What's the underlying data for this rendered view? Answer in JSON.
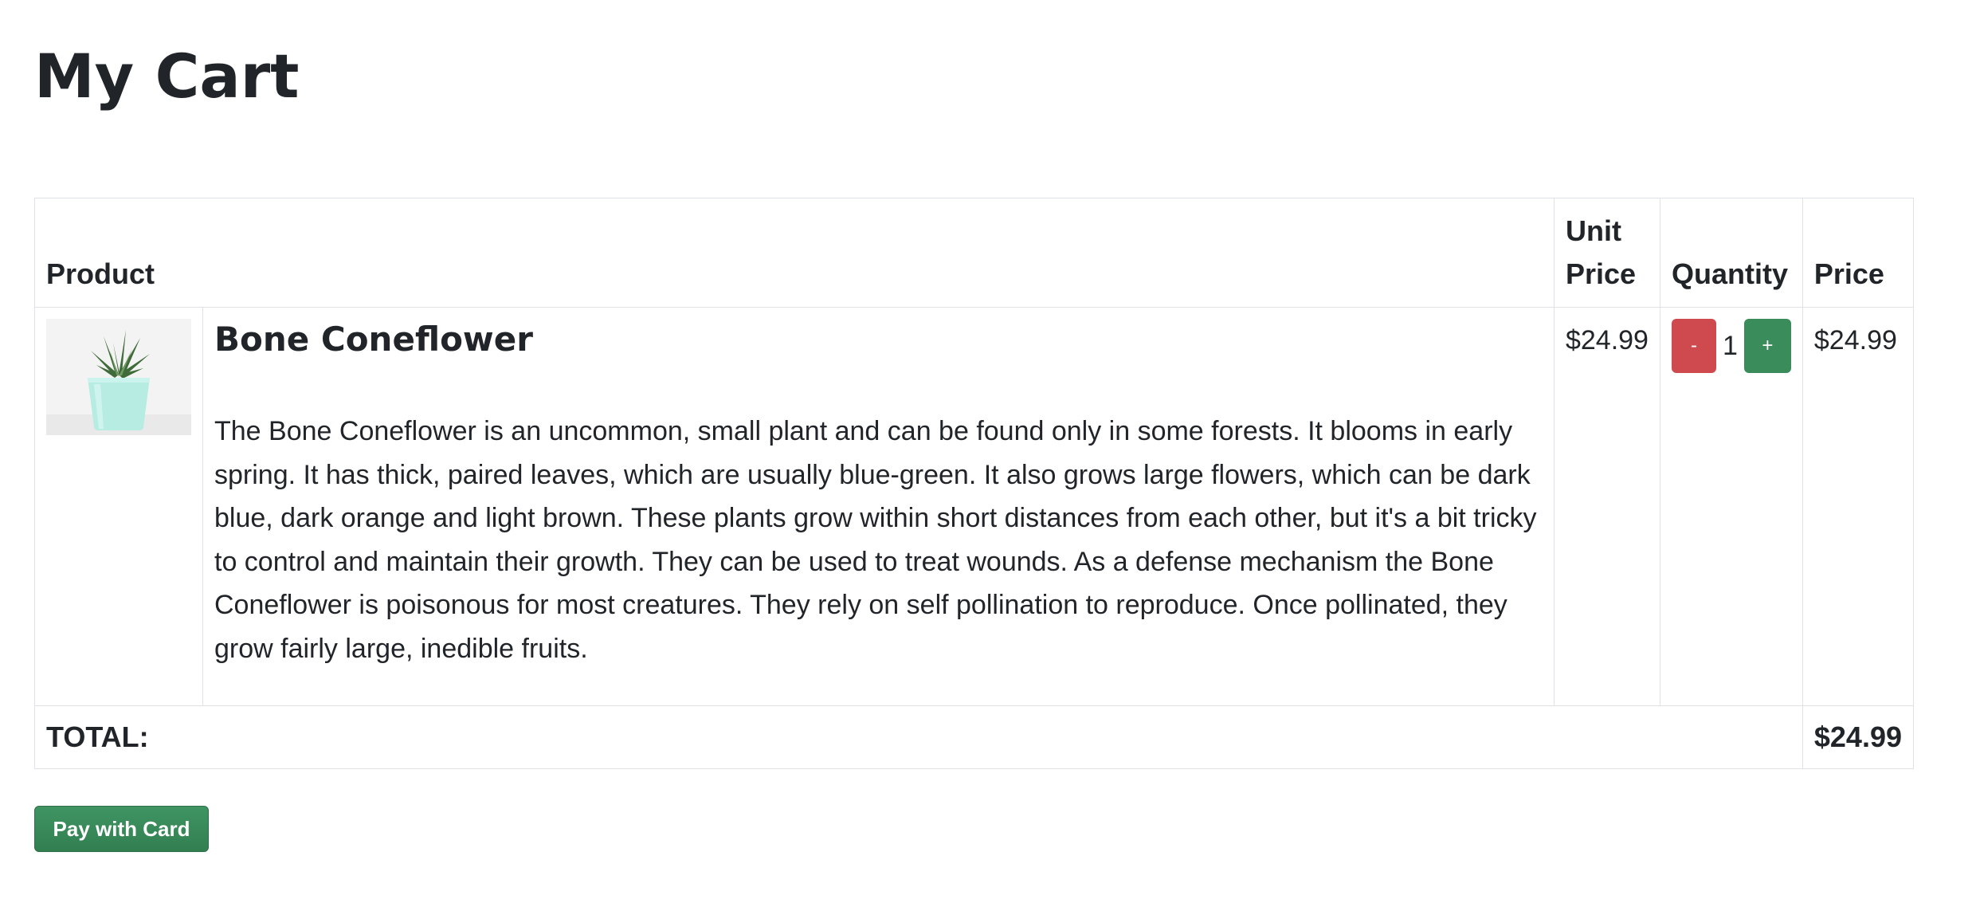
{
  "page": {
    "title": "My Cart"
  },
  "table": {
    "headers": {
      "product": "Product",
      "unit_price": "Unit Price",
      "quantity": "Quantity",
      "price": "Price"
    },
    "items": [
      {
        "name": "Bone Coneflower",
        "description": "The Bone Coneflower is an uncommon, small plant and can be found only in some forests. It blooms in early spring. It has thick, paired leaves, which are usually blue-green. It also grows large flowers, which can be dark blue, dark orange and light brown. These plants grow within short distances from each other, but it's a bit tricky to control and maintain their growth. They can be used to treat wounds. As a defense mechanism the Bone Coneflower is poisonous for most creatures. They rely on self pollination to reproduce. Once pollinated, they grow fairly large, inedible fruits.",
        "unit_price": "$24.99",
        "quantity": "1",
        "price": "$24.99",
        "image_icon": "potted-succulent-icon",
        "decrement_label": "-",
        "increment_label": "+"
      }
    ],
    "total_label": "TOTAL:",
    "total_value": "$24.99"
  },
  "actions": {
    "pay_label": "Pay with Card"
  },
  "colors": {
    "text": "#212529",
    "border": "#dee2e6",
    "danger": "#cf4a4e",
    "success": "#3a8c5b"
  }
}
